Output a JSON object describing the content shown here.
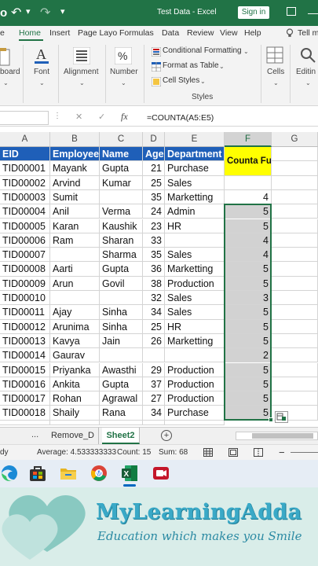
{
  "window": {
    "title": "Test Data  -  Excel",
    "signin_label": "Sign in"
  },
  "tabs": [
    "e",
    "Home",
    "Insert",
    "Page Layo",
    "Formulas",
    "Data",
    "Review",
    "View",
    "Help",
    "Tell m"
  ],
  "ribbon": {
    "board_label": "board",
    "font_label": "Font",
    "alignment_label": "Alignment",
    "number_label": "Number",
    "cond_format_label": "Conditional Formatting",
    "format_table_label": "Format as Table",
    "cell_styles_label": "Cell Styles",
    "styles_group_label": "Styles",
    "cells_label": "Cells",
    "editing_label": "Editin"
  },
  "formula_bar": {
    "fx": "fx",
    "formula": "=COUNTA(A5:E5)"
  },
  "grid": {
    "col_headers": [
      "A",
      "B",
      "C",
      "D",
      "E",
      "F",
      "G"
    ],
    "table_headers": [
      "EID",
      "Employee",
      "Name",
      "Age",
      "Department"
    ],
    "counta_label": "Counta Function",
    "rows": [
      {
        "eid": "TID00001",
        "employee": "Mayank",
        "name": "Gupta",
        "age": "21",
        "dept": "Purchase",
        "count": ""
      },
      {
        "eid": "TID00002",
        "employee": "Arvind",
        "name": "Kumar",
        "age": "25",
        "dept": "Sales",
        "count": ""
      },
      {
        "eid": "TID00003",
        "employee": "Sumit",
        "name": "",
        "age": "35",
        "dept": "Marketting",
        "count": "4"
      },
      {
        "eid": "TID00004",
        "employee": "Anil",
        "name": "Verma",
        "age": "24",
        "dept": "Admin",
        "count": "5"
      },
      {
        "eid": "TID00005",
        "employee": "Karan",
        "name": "Kaushik",
        "age": "23",
        "dept": "HR",
        "count": "5"
      },
      {
        "eid": "TID00006",
        "employee": "Ram",
        "name": "Sharan",
        "age": "33",
        "dept": "",
        "count": "4"
      },
      {
        "eid": "TID00007",
        "employee": "",
        "name": "Sharma",
        "age": "35",
        "dept": "Sales",
        "count": "4"
      },
      {
        "eid": "TID00008",
        "employee": "Aarti",
        "name": "Gupta",
        "age": "36",
        "dept": "Marketting",
        "count": "5"
      },
      {
        "eid": "TID00009",
        "employee": "Arun",
        "name": "Govil",
        "age": "38",
        "dept": "Production",
        "count": "5"
      },
      {
        "eid": "TID00010",
        "employee": "",
        "name": "",
        "age": "32",
        "dept": "Sales",
        "count": "3"
      },
      {
        "eid": "TID00011",
        "employee": "Ajay",
        "name": "Sinha",
        "age": "34",
        "dept": "Sales",
        "count": "5"
      },
      {
        "eid": "TID00012",
        "employee": "Arunima",
        "name": "Sinha",
        "age": "25",
        "dept": "HR",
        "count": "5"
      },
      {
        "eid": "TID00013",
        "employee": "Kavya",
        "name": "Jain",
        "age": "26",
        "dept": "Marketting",
        "count": "5"
      },
      {
        "eid": "TID00014",
        "employee": "Gaurav",
        "name": "",
        "age": "",
        "dept": "",
        "count": "2"
      },
      {
        "eid": "TID00015",
        "employee": "Priyanka",
        "name": "Awasthi",
        "age": "29",
        "dept": "Production",
        "count": "5"
      },
      {
        "eid": "TID00016",
        "employee": "Ankita",
        "name": "Gupta",
        "age": "37",
        "dept": "Production",
        "count": "5"
      },
      {
        "eid": "TID00017",
        "employee": "Rohan",
        "name": "Agrawal",
        "age": "27",
        "dept": "Production",
        "count": "5"
      },
      {
        "eid": "TID00018",
        "employee": "Shaily",
        "name": "Rana",
        "age": "34",
        "dept": "Purchase",
        "count": "5"
      }
    ]
  },
  "sheets": {
    "dots": "...",
    "tabs": [
      "Remove_D",
      "Sheet2"
    ],
    "active": "Sheet2"
  },
  "status": {
    "mode": "dy",
    "average": "Average: 4.533333333",
    "count": "Count: 15",
    "sum": "Sum: 68"
  },
  "taskbar": {
    "icons": [
      "edge-icon",
      "store-icon",
      "file-explorer-icon",
      "chrome-icon",
      "excel-icon",
      "camera-recorder-icon"
    ]
  },
  "banner": {
    "brand": "MyLearningAdda",
    "tagline": "Education which makes you Smile"
  },
  "colors": {
    "excel_green": "#217346",
    "header_blue": "#1f5fb8",
    "yellow": "#ffff00",
    "brand_teal": "#3aa9c7"
  }
}
